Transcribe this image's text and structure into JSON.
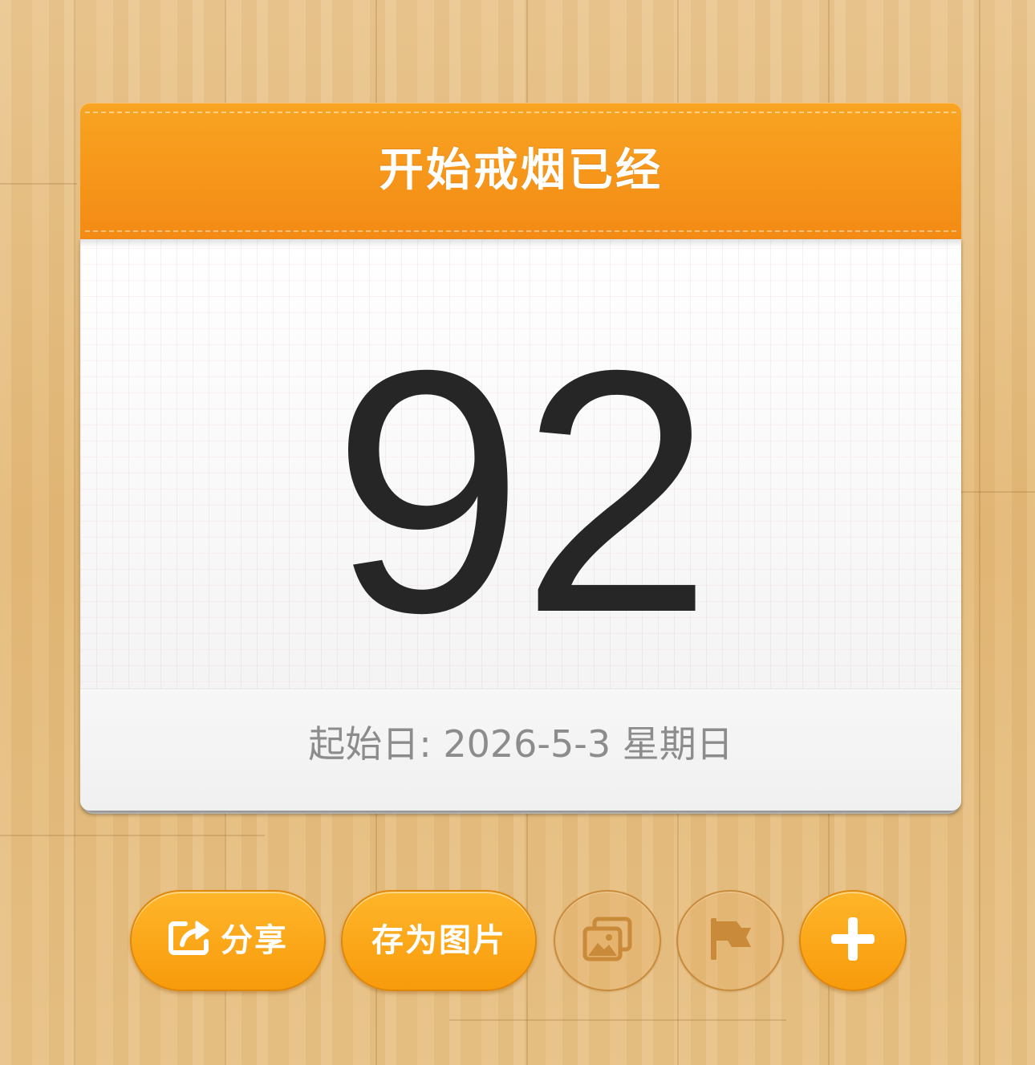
{
  "calendar": {
    "header_title": "开始戒烟已经",
    "day_count": "92",
    "start_date_label": "起始日: 2026-5-3 星期日"
  },
  "toolbar": {
    "share_label": "分享",
    "save_image_label": "存为图片",
    "icons": {
      "share": "share-icon",
      "gallery": "gallery-icon",
      "flag": "flag-icon",
      "add": "plus-icon"
    }
  },
  "colors": {
    "accent": "#f7960f",
    "header_orange": "#f38a14",
    "number_text": "#262626",
    "date_text": "#8c8c8c",
    "ghost_icon": "#c98a3a"
  }
}
